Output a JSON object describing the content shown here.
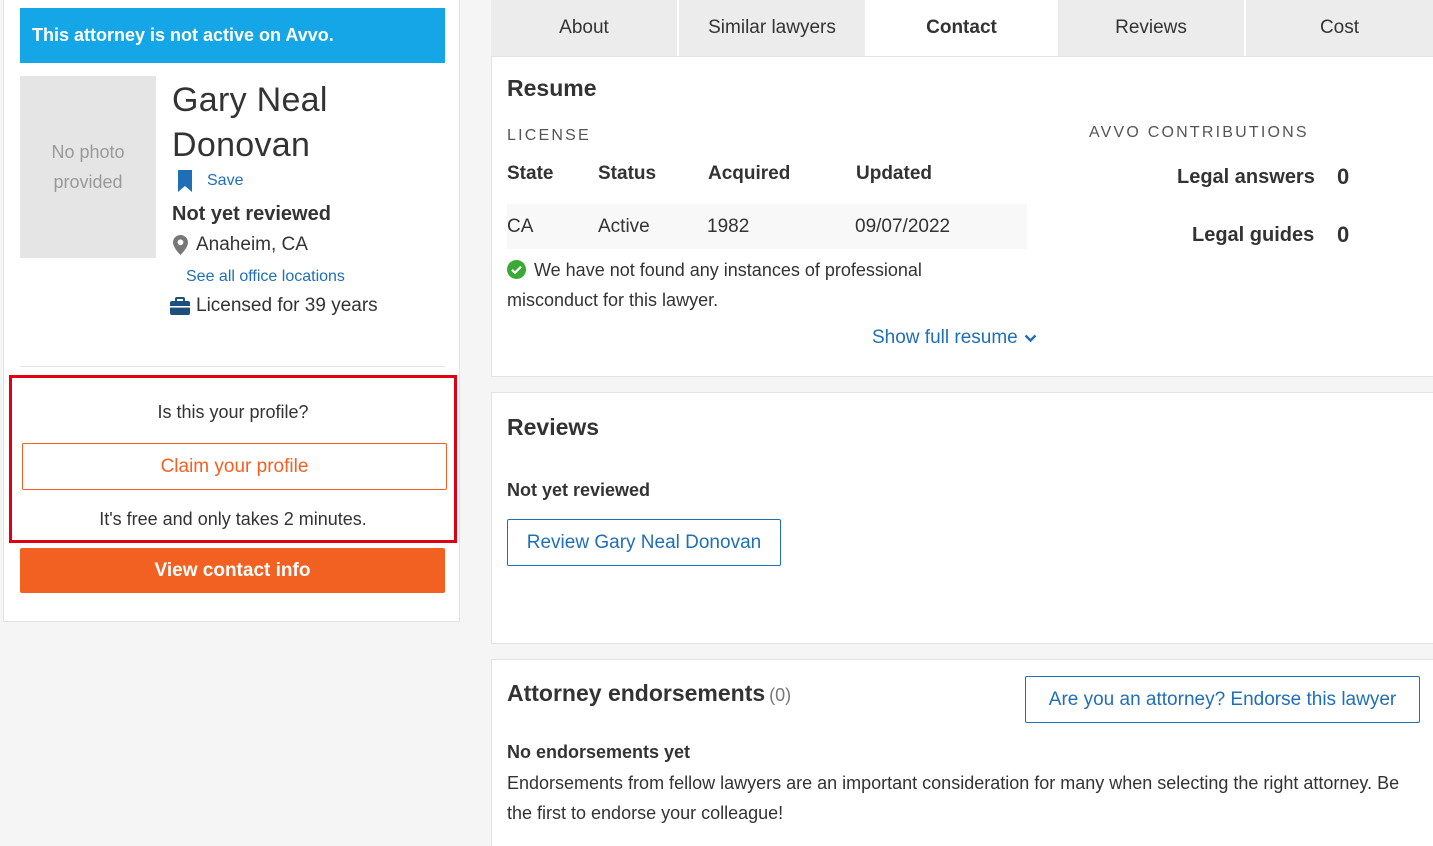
{
  "banner": {
    "text": "This attorney is not active on Avvo."
  },
  "profile": {
    "photo_placeholder": "No photo provided",
    "name": "Gary Neal Donovan",
    "save_label": "Save",
    "review_status": "Not yet reviewed",
    "location": "Anaheim, CA",
    "office_link": "See all office locations",
    "licensed": "Licensed for 39 years"
  },
  "claim": {
    "question": "Is this your profile?",
    "button": "Claim your profile",
    "note": "It's free and only takes 2 minutes."
  },
  "contact_button": "View contact info",
  "tabs": [
    {
      "label": "About",
      "active": false
    },
    {
      "label": "Similar lawyers",
      "active": false
    },
    {
      "label": "Contact",
      "active": true
    },
    {
      "label": "Reviews",
      "active": false
    },
    {
      "label": "Cost",
      "active": false
    }
  ],
  "resume": {
    "title": "Resume",
    "license_label": "LICENSE",
    "headers": [
      "State",
      "Status",
      "Acquired",
      "Updated"
    ],
    "row": [
      "CA",
      "Active",
      "1982",
      "09/07/2022"
    ],
    "misconduct": "We have not found any instances of professional misconduct for this lawyer.",
    "show_full": "Show full resume",
    "contributions_label": "AVVO CONTRIBUTIONS",
    "contributions": [
      {
        "label": "Legal answers",
        "value": "0"
      },
      {
        "label": "Legal guides",
        "value": "0"
      }
    ]
  },
  "reviews": {
    "title": "Reviews",
    "status": "Not yet reviewed",
    "button": "Review Gary Neal Donovan"
  },
  "endorsements": {
    "title": "Attorney endorsements",
    "count": "(0)",
    "button": "Are you an attorney? Endorse this lawyer",
    "empty_title": "No endorsements yet",
    "description": "Endorsements from fellow lawyers are an important consideration for many when selecting the right attorney. Be the first to endorse your colleague!"
  },
  "colors": {
    "banner": "#14a6e6",
    "accent": "#f26122",
    "link": "#1f6fb8",
    "highlight": "#e10012",
    "success": "#3aaa35"
  },
  "icons": [
    "bookmark-icon",
    "location-pin-icon",
    "briefcase-icon",
    "check-circle-icon",
    "chevron-down-icon"
  ]
}
